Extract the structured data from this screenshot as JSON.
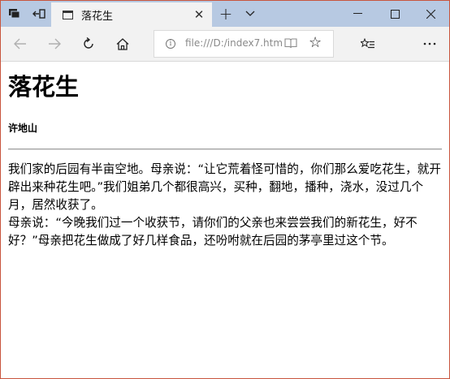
{
  "browser": {
    "tab": {
      "title": "落花生"
    },
    "address": {
      "url": "file:///D:/index7.htm"
    }
  },
  "icons": {
    "tab_actions": "tab-actions-icon",
    "set_aside": "set-aside-tabs-icon",
    "page": "page-icon",
    "close": "close-icon",
    "new_tab": "plus-icon",
    "tab_menu": "chevron-down-icon",
    "minimize": "minimize-icon",
    "maximize": "maximize-icon",
    "window_close": "window-close-icon",
    "back": "back-arrow-icon",
    "forward": "forward-arrow-icon",
    "refresh": "refresh-icon",
    "home": "home-icon",
    "info": "info-icon",
    "reading_view": "reading-view-icon",
    "favorite": "star-icon",
    "favorites_hub": "favorites-hub-icon",
    "more": "more-icon"
  },
  "colors": {
    "titlebar": "#b7c9e2",
    "toolbar": "#f2f2f2",
    "window_border": "#c8553d"
  },
  "page": {
    "title": "落花生",
    "author": "许地山",
    "paragraphs": [
      "我们家的后园有半亩空地。母亲说：“让它荒着怪可惜的，你们那么爱吃花生，就开辟出来种花生吧。”我们姐弟几个都很高兴，买种，翻地，播种，浇水，没过几个月，居然收获了。",
      "母亲说：“今晚我们过一个收获节，请你们的父亲也来尝尝我们的新花生，好不好？”母亲把花生做成了好几样食品，还吩咐就在后园的茅亭里过这个节。"
    ]
  }
}
